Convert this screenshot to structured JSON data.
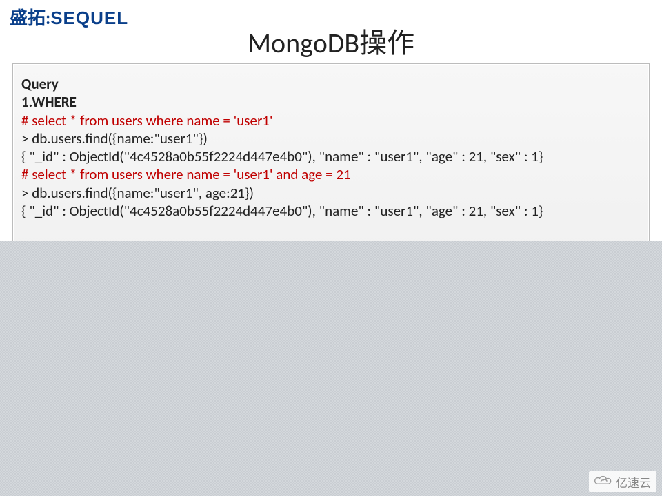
{
  "logo": {
    "cn": "盛拓",
    "colon": ":",
    "en": "SEQUEL"
  },
  "title": "MongoDB操作",
  "code": {
    "line1": "Query",
    "line2": "1.WHERE",
    "line3": "# select * from users where name = 'user1'",
    "line4": " > db.users.find({name:\"user1\"})",
    "line5": "{ \"_id\" : ObjectId(\"4c4528a0b55f2224d447e4b0\"), \"name\" : \"user1\", \"age\" : 21, \"sex\" : 1}",
    "line6": "# select * from users where name = 'user1' and age = 21",
    "line7": " > db.users.find({name:\"user1\",  age:21})",
    "line8": "{ \"_id\" : ObjectId(\"4c4528a0b55f2224d447e4b0\"), \"name\" : \"user1\", \"age\" : 21, \"sex\" : 1}"
  },
  "watermark": "亿速云"
}
